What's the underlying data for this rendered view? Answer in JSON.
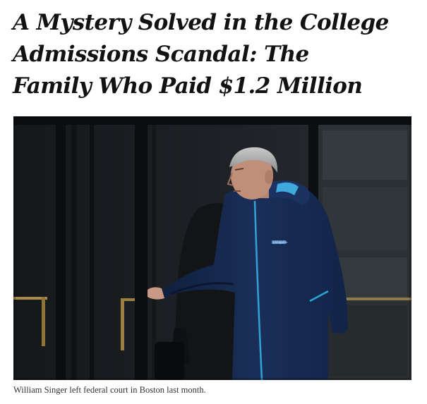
{
  "article": {
    "headline_lines": [
      "A Mystery Solved in the College",
      "Admissions Scandal: The",
      "Family Who Paid $1.2 Million"
    ],
    "photo": {
      "jacket_brand": "patagonia"
    },
    "caption": "William Singer left federal court in Boston last month."
  }
}
